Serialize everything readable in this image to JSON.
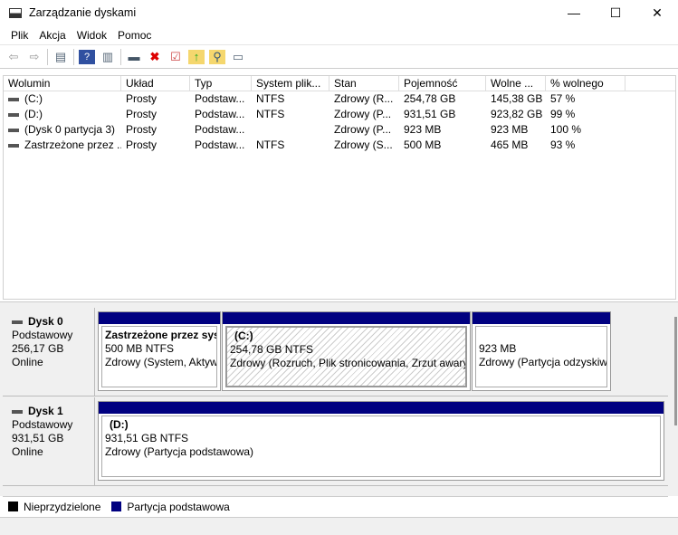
{
  "window": {
    "title": "Zarządzanie dyskami",
    "minimize": "—",
    "maximize": "☐",
    "close": "✕"
  },
  "menu": [
    "Plik",
    "Akcja",
    "Widok",
    "Pomoc"
  ],
  "toolbar": [
    "back-icon",
    "forward-icon",
    "console-tree-icon",
    "help-icon",
    "properties-view-icon",
    "connect-icon",
    "delete-icon",
    "check-icon",
    "import-icon",
    "search-icon",
    "settings-icon"
  ],
  "table": {
    "columns": [
      "Wolumin",
      "Układ",
      "Typ",
      "System plik...",
      "Stan",
      "Pojemność",
      "Wolne ...",
      "% wolnego"
    ],
    "rows": [
      [
        "(C:)",
        "Prosty",
        "Podstaw...",
        "NTFS",
        "Zdrowy (R...",
        "254,78 GB",
        "145,38 GB",
        "57 %"
      ],
      [
        "(D:)",
        "Prosty",
        "Podstaw...",
        "NTFS",
        "Zdrowy (P...",
        "931,51 GB",
        "923,82 GB",
        "99 %"
      ],
      [
        "(Dysk 0 partycja 3)",
        "Prosty",
        "Podstaw...",
        "",
        "Zdrowy (P...",
        "923 MB",
        "923 MB",
        "100 %"
      ],
      [
        "Zastrzeżone przez ...",
        "Prosty",
        "Podstaw...",
        "NTFS",
        "Zdrowy (S...",
        "500 MB",
        "465 MB",
        "93 %"
      ]
    ]
  },
  "disks": [
    {
      "name": "Dysk 0",
      "type": "Podstawowy",
      "size": "256,17 GB",
      "status": "Online",
      "partitions": [
        {
          "name": "Zastrzeżone przez sys",
          "size": "500 MB NTFS",
          "status": "Zdrowy (System, Aktyw"
        },
        {
          "name": "(C:)",
          "size": "254,78 GB NTFS",
          "status": "Zdrowy (Rozruch, Plik stronicowania, Zrzut awary"
        },
        {
          "name": "",
          "size": "923 MB",
          "status": "Zdrowy (Partycja odzyskiw"
        }
      ]
    },
    {
      "name": "Dysk 1",
      "type": "Podstawowy",
      "size": "931,51 GB",
      "status": "Online",
      "partitions": [
        {
          "name": "(D:)",
          "size": "931,51 GB NTFS",
          "status": "Zdrowy (Partycja podstawowa)"
        }
      ]
    }
  ],
  "legend": [
    {
      "label": "Nieprzydzielone",
      "color": "#000000"
    },
    {
      "label": "Partycja podstawowa",
      "color": "#000080"
    }
  ]
}
